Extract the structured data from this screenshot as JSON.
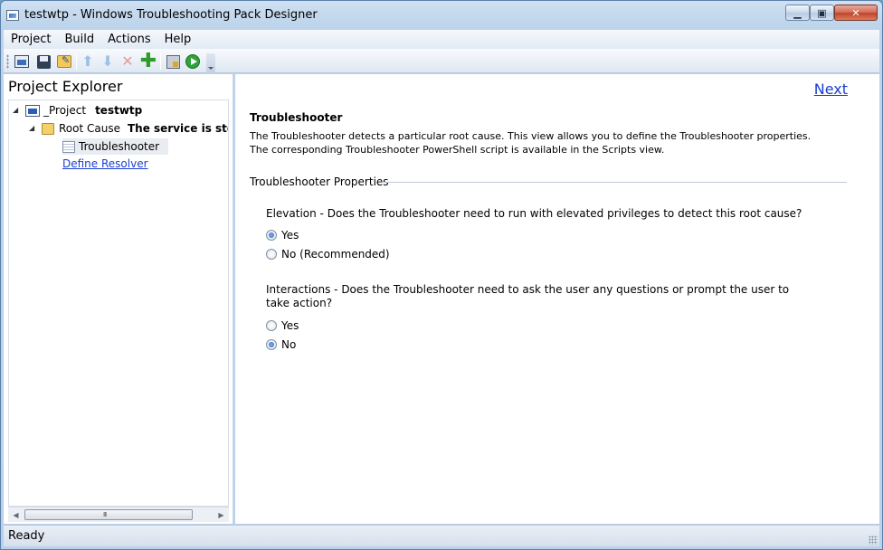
{
  "window": {
    "title": "testwtp - Windows Troubleshooting Pack Designer",
    "min_glyph": "▁",
    "max_glyph": "▣",
    "close_glyph": "✕"
  },
  "menu": {
    "items": [
      "Project",
      "Build",
      "Actions",
      "Help"
    ]
  },
  "toolbar": {
    "icons": [
      "new-project-icon",
      "save-icon",
      "edit-project-icon",
      "move-up-icon",
      "move-down-icon",
      "delete-icon",
      "add-icon",
      "build-icon",
      "run-icon"
    ]
  },
  "explorer": {
    "title": "Project Explorer",
    "project_label": "_Project",
    "project_name": "testwtp",
    "root_cause_label": "Root Cause",
    "root_cause_name": "The service is stop",
    "troubleshooter_label": "Troubleshooter",
    "define_resolver_label": "Define Resolver",
    "scroll_grip": "III"
  },
  "main": {
    "next_label": "Next",
    "section_title": "Troubleshooter",
    "description": "The Troubleshooter detects a particular root cause. This view allows you to define the Troubleshooter properties. The corresponding Troubleshooter PowerShell script is available in the Scripts view.",
    "group_label": "Troubleshooter Properties",
    "elevation": {
      "question": "Elevation - Does the Troubleshooter need to run with elevated privileges to detect this root cause?",
      "options": [
        "Yes",
        "No (Recommended)"
      ],
      "selected": "Yes"
    },
    "interactions": {
      "question": "Interactions - Does the Troubleshooter need to ask the user any questions or prompt the user to take action?",
      "options": [
        "Yes",
        "No"
      ],
      "selected": "No"
    }
  },
  "status": {
    "text": "Ready"
  },
  "colors": {
    "link": "#1a3ed1",
    "accent": "#2a63c2"
  }
}
